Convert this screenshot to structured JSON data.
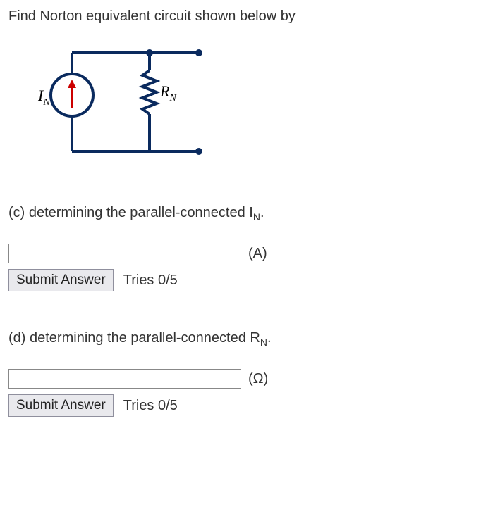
{
  "title": "Find Norton equivalent circuit shown below by",
  "diagram": {
    "source_label": "I",
    "source_sub": "N",
    "resistor_label": "R",
    "resistor_sub": "N"
  },
  "part_c": {
    "label": "(c) determining the parallel-connected I",
    "sub": "N",
    "suffix": ".",
    "unit": "(A)",
    "submit": "Submit Answer",
    "tries": "Tries 0/5",
    "value": ""
  },
  "part_d": {
    "label": "(d) determining the parallel-connected R",
    "sub": "N",
    "suffix": ".",
    "unit": "(Ω)",
    "submit": "Submit Answer",
    "tries": "Tries 0/5",
    "value": ""
  }
}
